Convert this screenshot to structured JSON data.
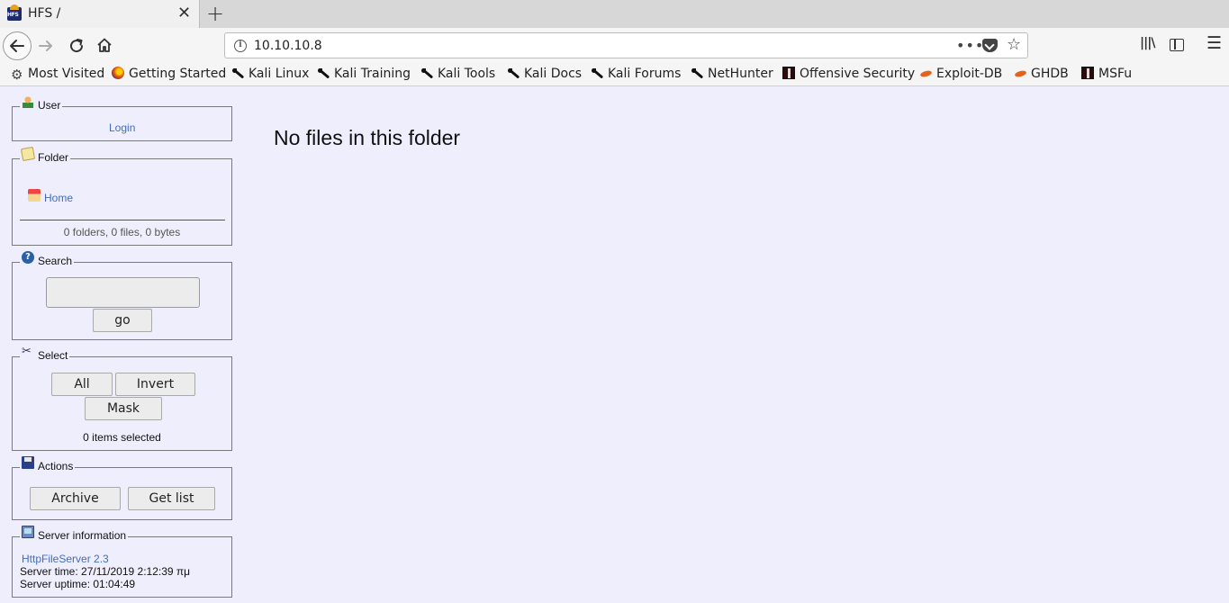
{
  "browser": {
    "tab_title": "HFS /",
    "url": "10.10.10.8",
    "bookmarks": [
      {
        "label": "Most Visited",
        "icon": "gear-icon"
      },
      {
        "label": "Getting Started",
        "icon": "firefox-icon"
      },
      {
        "label": "Kali Linux",
        "icon": "kali-icon"
      },
      {
        "label": "Kali Training",
        "icon": "kali-icon"
      },
      {
        "label": "Kali Tools",
        "icon": "kali-icon"
      },
      {
        "label": "Kali Docs",
        "icon": "kali-icon"
      },
      {
        "label": "Kali Forums",
        "icon": "kali-icon"
      },
      {
        "label": "NetHunter",
        "icon": "kali-icon"
      },
      {
        "label": "Offensive Security",
        "icon": "offsec-icon"
      },
      {
        "label": "Exploit-DB",
        "icon": "exploitdb-icon"
      },
      {
        "label": "GHDB",
        "icon": "exploitdb-icon"
      },
      {
        "label": "MSFu",
        "icon": "offsec-icon"
      }
    ]
  },
  "sidebar": {
    "user": {
      "title": "User",
      "login_link": "Login"
    },
    "folder": {
      "title": "Folder",
      "home_link": "Home",
      "summary": "0 folders, 0 files, 0 bytes"
    },
    "search": {
      "title": "Search",
      "input_value": "",
      "go_label": "go"
    },
    "select": {
      "title": "Select",
      "all_label": "All",
      "invert_label": "Invert",
      "mask_label": "Mask",
      "status": "0 items selected"
    },
    "actions": {
      "title": "Actions",
      "archive_label": "Archive",
      "getlist_label": "Get list"
    },
    "server": {
      "title": "Server information",
      "version_link": "HttpFileServer 2.3",
      "server_time": "Server time: 27/11/2019 2:12:39 πμ",
      "uptime": "Server uptime: 01:04:49"
    }
  },
  "main": {
    "message": "No files in this folder"
  }
}
